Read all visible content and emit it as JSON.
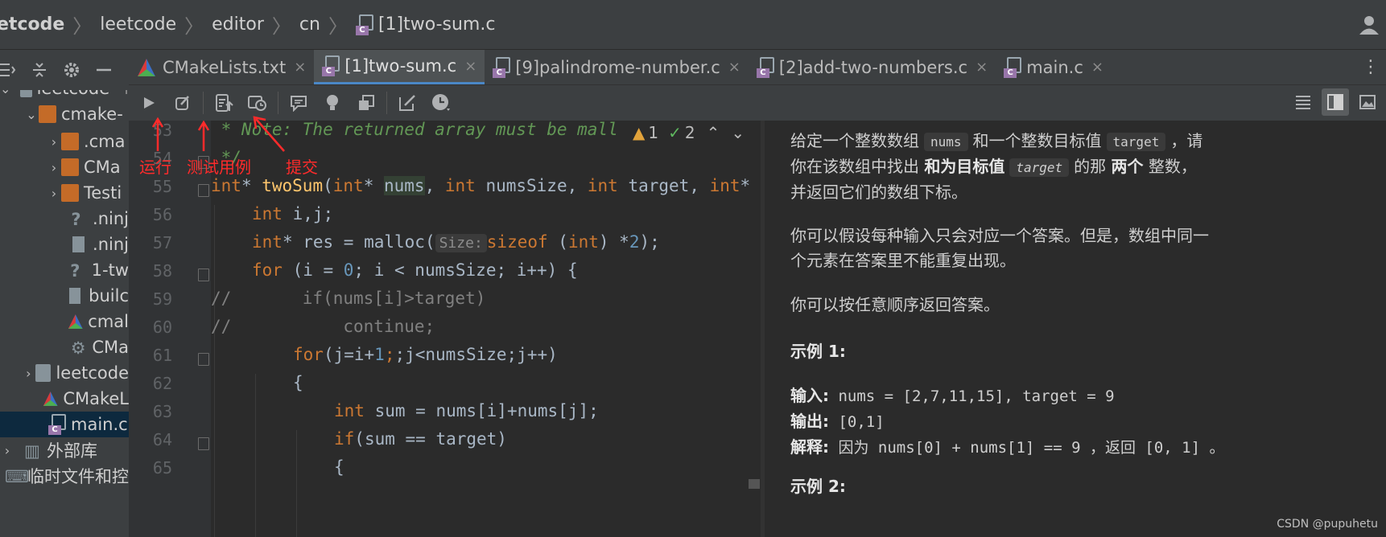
{
  "breadcrumb": {
    "items": [
      "etcode",
      "leetcode",
      "editor",
      "cn",
      "[1]two-sum.c"
    ]
  },
  "project_tree": {
    "items": [
      {
        "label": "leetcode",
        "extra": "l"
      },
      {
        "label": "cmake-"
      },
      {
        "label": ".cma"
      },
      {
        "label": "CMa"
      },
      {
        "label": "Testi"
      },
      {
        "label": ".ninj"
      },
      {
        "label": ".ninj"
      },
      {
        "label": "1-tw"
      },
      {
        "label": "builc"
      },
      {
        "label": "cmal"
      },
      {
        "label": "CMa"
      },
      {
        "label": "leetcode"
      },
      {
        "label": "CMakeL"
      },
      {
        "label": "main.c"
      },
      {
        "label": "外部库"
      },
      {
        "label": "临时文件和控"
      }
    ]
  },
  "tabs": [
    {
      "label": "CMakeLists.txt",
      "active": false
    },
    {
      "label": "[1]two-sum.c",
      "active": true
    },
    {
      "label": "[9]palindrome-number.c",
      "active": false
    },
    {
      "label": "[2]add-two-numbers.c",
      "active": false
    },
    {
      "label": "main.c",
      "active": false
    }
  ],
  "tab_close": "×",
  "inspections": {
    "warnings": "1",
    "ok": "2"
  },
  "editor": {
    "line_numbers": [
      "53",
      "54",
      "55",
      "56",
      "57",
      "58",
      "59",
      "60",
      "61",
      "62",
      "63",
      "64",
      "65"
    ],
    "lines": {
      "l53": " * Note: The returned array must be mall",
      "l54": " */",
      "l55_kw": "int",
      "l55_star": "* ",
      "l55_fn": "twoSum",
      "l55_p1": "(",
      "l55_kw2": "int",
      "l55_p2": "* ",
      "l55_hl": "nums",
      "l55_p3": ", ",
      "l55_kw3": "int",
      "l55_p4": " numsSize, ",
      "l55_kw4": "int",
      "l55_p5": " target, ",
      "l55_kw5": "int",
      "l55_p6": "*",
      "l56_kw": "int",
      "l56_rest": " i,j;",
      "l57_kw": "int",
      "l57_a": "* res = malloc(",
      "l57_hint": "Size:",
      "l57_kw2": "sizeof",
      "l57_b": " (",
      "l57_kw3": "int",
      "l57_c": ") *",
      "l57_num": "2",
      "l57_d": ");",
      "l58_kw": "for",
      "l58_a": " (i = ",
      "l58_num": "0",
      "l58_b": "; i < numsSize; i++) {",
      "l59": "//       if(nums[i]>target)",
      "l60": "//           continue;",
      "l61_kw": "for",
      "l61_a": "(j=i+",
      "l61_num": "1",
      "l61_b": ";j<numsSize;j++)",
      "l62": "{",
      "l63_kw": "int",
      "l63_rest": " sum = nums[i]+nums[j];",
      "l64_kw": "if",
      "l64_rest": "(sum == target)",
      "l65": "{"
    }
  },
  "description": {
    "p1_a": "给定一个整数数组",
    "p1_code1": "nums",
    "p1_b": "和一个整数目标值",
    "p1_code2": "target",
    "p1_c": "，请",
    "p1_d": "你在该数组中找出",
    "p1_bold1": "和为目标值",
    "p1_code3": "target",
    "p1_e": "的那",
    "p1_bold2": "两个",
    "p1_f": "整数，",
    "p1_g": "并返回它们的数组下标。",
    "p2_a": "你可以假设每种输入只会对应一个答案。但是，数组中同一",
    "p2_b": "个元素在答案里不能重复出现。",
    "p3": "你可以按任意顺序返回答案。",
    "ex1_title": "示例 1:",
    "ex1_in_label": "输入:",
    "ex1_in": " nums = [2,7,11,15], target = 9",
    "ex1_out_label": "输出:",
    "ex1_out": " [0,1]",
    "ex1_exp_label": "解释:",
    "ex1_exp": " 因为 nums[0] + nums[1] == 9 ，返回 [0, 1] 。",
    "ex2_title": "示例 2:"
  },
  "annotations": {
    "run": "运行",
    "test": "测试用例",
    "submit": "提交"
  },
  "watermark": "CSDN @pupuhetu",
  "colors": {
    "annotation": "#ff2b2b",
    "accent": "#4a88c7",
    "keyword": "#cc7832",
    "function": "#ffc66d",
    "number": "#6897bb"
  }
}
